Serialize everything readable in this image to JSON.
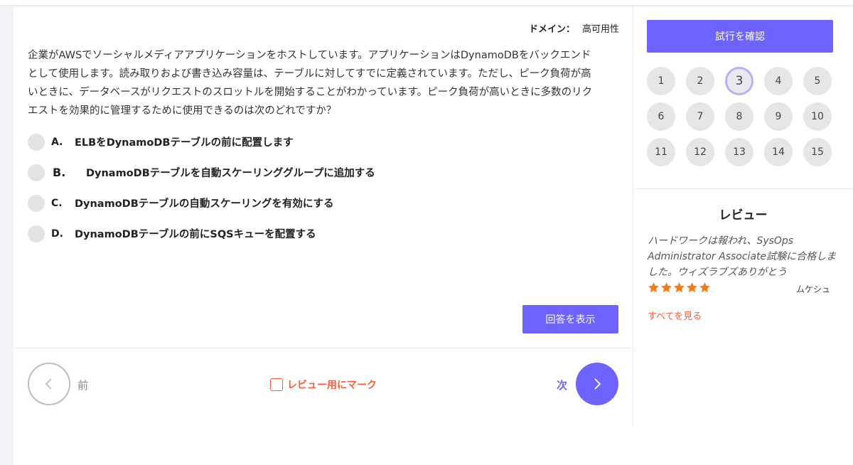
{
  "question": {
    "domain_label": "ドメイン：",
    "domain_value": "高可用性",
    "text": "企業がAWSでソーシャルメディアアプリケーションをホストしています。アプリケーションはDynamoDBをバックエンドとして使用します。読み取りおよび書き込み容量は、テーブルに対してすでに定義されています。ただし、ピーク負荷が高いときに、データベースがリクエストのスロットルを開始することがわかっています。ピーク負荷が高いときに多数のリクエストを効果的に管理するために使用できるのは次のどれですか？",
    "options": [
      {
        "letter": "A.",
        "text": "ELBをDynamoDBテーブルの前に配置します"
      },
      {
        "letter": "B.",
        "text": "DynamoDBテーブルを自動スケーリンググループに追加する"
      },
      {
        "letter": "C.",
        "text": "DynamoDBテーブルの自動スケーリングを有効にする"
      },
      {
        "letter": "D.",
        "text": "DynamoDBテーブルの前にSQSキューを配置する"
      }
    ],
    "show_answer_label": "回答を表示"
  },
  "navigation": {
    "prev_label": "前",
    "mark_label": "レビュー用にマーク",
    "next_label": "次"
  },
  "sidebar": {
    "check_trial_label": "試行を確認",
    "question_numbers": [
      "1",
      "2",
      "3",
      "4",
      "5",
      "6",
      "7",
      "8",
      "9",
      "10",
      "11",
      "12",
      "13",
      "14",
      "15"
    ],
    "current_question": "3",
    "review": {
      "title": "レビュー",
      "text": "ハードワークは報われ、SysOps Administrator Associate試験に合格しました。ウィズラブズありがとう",
      "rating": 5,
      "reviewer": "ムケシュ",
      "see_all_label": "すべてを見る"
    }
  },
  "colors": {
    "accent": "#6d63ff",
    "mark": "#ff5a36",
    "star": "#f07c1e"
  },
  "icons": {
    "prev": "chevron-left-icon",
    "next": "chevron-right-icon",
    "star": "star-icon"
  }
}
